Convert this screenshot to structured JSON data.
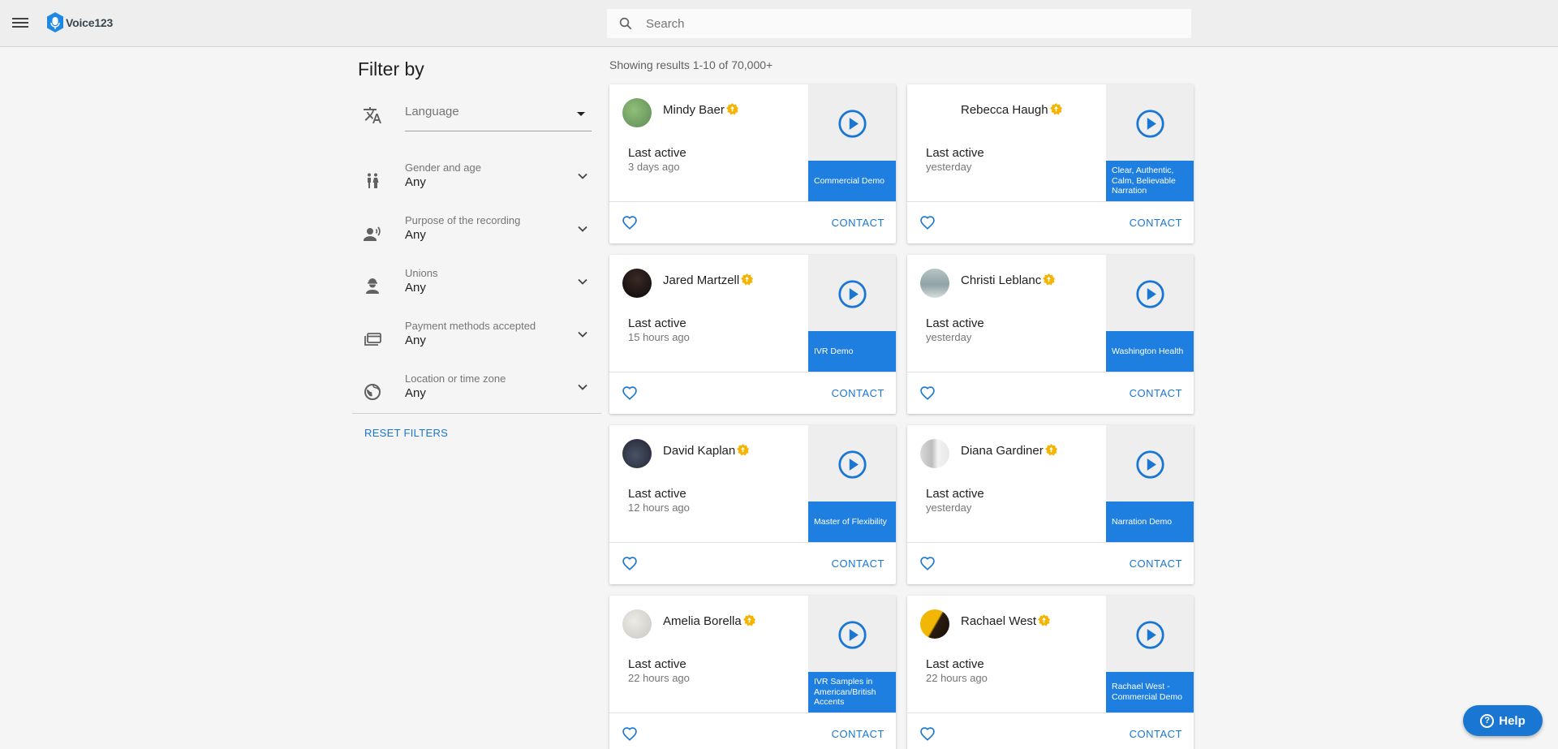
{
  "app": {
    "logo_text": "Voice123"
  },
  "search": {
    "placeholder": "Search"
  },
  "filters": {
    "title": "Filter by",
    "language_placeholder": "Language",
    "items": [
      {
        "label": "Gender and age",
        "value": "Any",
        "icon": "gender-icon"
      },
      {
        "label": "Purpose of the recording",
        "value": "Any",
        "icon": "recording-voice-icon"
      },
      {
        "label": "Unions",
        "value": "Any",
        "icon": "union-person-icon"
      },
      {
        "label": "Payment methods accepted",
        "value": "Any",
        "icon": "payment-card-icon"
      },
      {
        "label": "Location or time zone",
        "value": "Any",
        "icon": "globe-icon"
      }
    ],
    "reset_label": "RESET FILTERS"
  },
  "results": {
    "summary": "Showing results 1-10 of 70,000+"
  },
  "cards": [
    {
      "name": "Mindy Baer",
      "last_active_label": "Last active",
      "last_active": "3 days ago",
      "demo": "Commercial Demo",
      "contact": "CONTACT"
    },
    {
      "name": "Rebecca Haugh",
      "last_active_label": "Last active",
      "last_active": "yesterday",
      "demo": "Clear, Authentic, Calm, Believable Narration",
      "contact": "CONTACT"
    },
    {
      "name": "Jared Martzell",
      "last_active_label": "Last active",
      "last_active": "15 hours ago",
      "demo": "IVR Demo",
      "contact": "CONTACT"
    },
    {
      "name": "Christi Leblanc",
      "last_active_label": "Last active",
      "last_active": "yesterday",
      "demo": "Washington Health",
      "contact": "CONTACT"
    },
    {
      "name": "David Kaplan",
      "last_active_label": "Last active",
      "last_active": "12 hours ago",
      "demo": "Master of Flexibility",
      "contact": "CONTACT"
    },
    {
      "name": "Diana Gardiner",
      "last_active_label": "Last active",
      "last_active": "yesterday",
      "demo": "Narration Demo",
      "contact": "CONTACT"
    },
    {
      "name": "Amelia Borella",
      "last_active_label": "Last active",
      "last_active": "22 hours ago",
      "demo": "IVR Samples in American/British Accents",
      "contact": "CONTACT"
    },
    {
      "name": "Rachael West",
      "last_active_label": "Last active",
      "last_active": "22 hours ago",
      "demo": "Rachael West - Commercial Demo",
      "contact": "CONTACT"
    }
  ],
  "help": {
    "label": "Help"
  },
  "colors": {
    "accent": "#1976d2",
    "demo_bg": "#1e7fe0",
    "badge": "#f5b400"
  }
}
